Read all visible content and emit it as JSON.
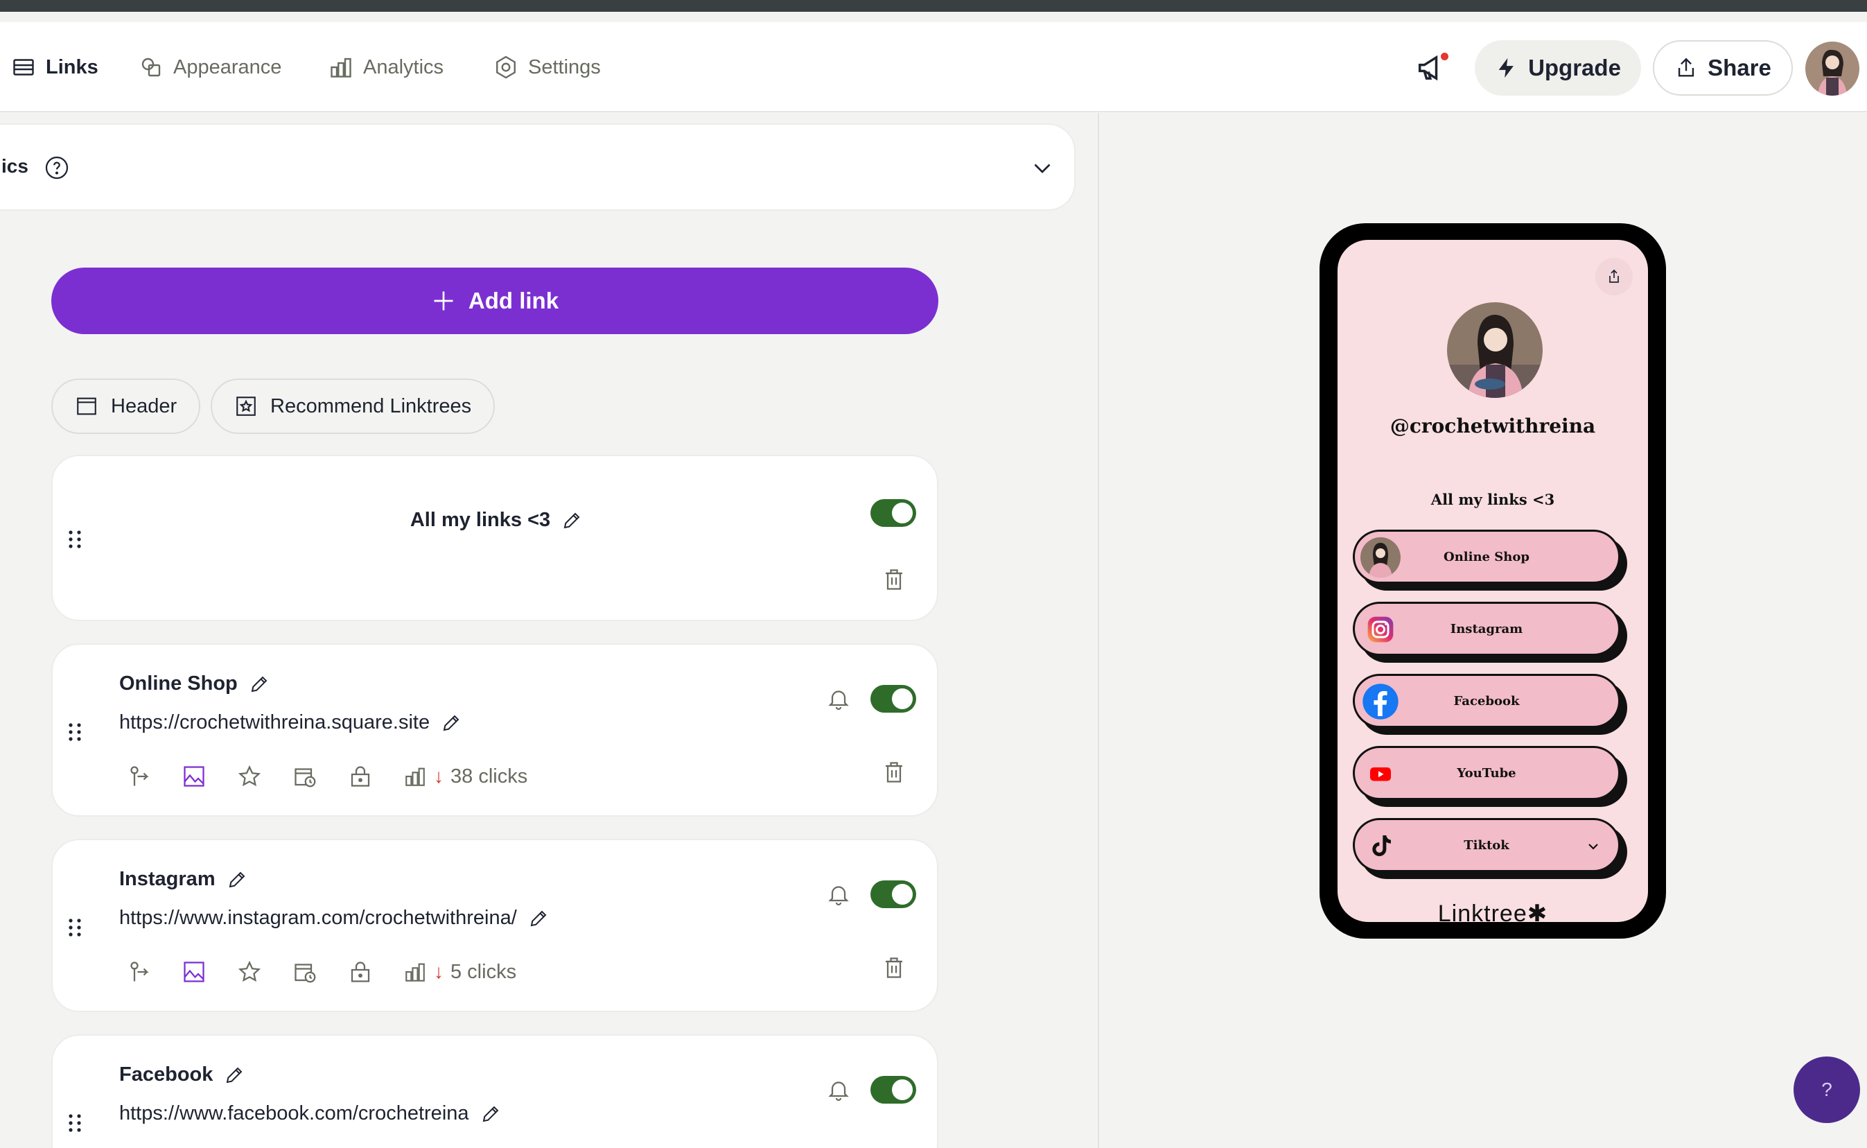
{
  "nav": {
    "items": [
      {
        "label": "Links",
        "icon": "list-icon",
        "active": true
      },
      {
        "label": "Appearance",
        "icon": "shapes-icon",
        "active": false
      },
      {
        "label": "Analytics",
        "icon": "bar-chart-icon",
        "active": false
      },
      {
        "label": "Settings",
        "icon": "gear-icon",
        "active": false
      }
    ],
    "upgrade_label": "Upgrade",
    "share_label": "Share",
    "notification_icon": "megaphone-icon"
  },
  "analytics_panel": {
    "title": "ics",
    "help_icon": "question-circle-icon",
    "expand_icon": "chevron-down-icon"
  },
  "add_link": {
    "label": "Add link",
    "icon": "plus-icon",
    "color": "#7b2fd1"
  },
  "pills": [
    {
      "label": "Header",
      "icon": "header-icon"
    },
    {
      "label": "Recommend Linktrees",
      "icon": "star-frame-icon"
    }
  ],
  "header_card": {
    "title": "All my links <3",
    "enabled": true
  },
  "link_cards": [
    {
      "title": "Online Shop",
      "url": "https://crochetwithreina.square.site",
      "clicks": "38 clicks",
      "enabled": true
    },
    {
      "title": "Instagram",
      "url": "https://www.instagram.com/crochetwithreina/",
      "clicks": "5 clicks",
      "enabled": true
    },
    {
      "title": "Facebook",
      "url": "https://www.facebook.com/crochetreina",
      "clicks": "",
      "enabled": true
    }
  ],
  "preview": {
    "handle": "@crochetwithreina",
    "bio": "All my links <3",
    "buttons": [
      {
        "label": "Online Shop",
        "icon": "profile-thumb-icon"
      },
      {
        "label": "Instagram",
        "icon": "instagram-icon"
      },
      {
        "label": "Facebook",
        "icon": "facebook-icon"
      },
      {
        "label": "YouTube",
        "icon": "youtube-icon"
      },
      {
        "label": "Tiktok",
        "icon": "tiktok-icon"
      }
    ],
    "footer_logo": "Linktree✱",
    "bg_color": "#f9dfe2",
    "button_color": "#f2bcc8"
  },
  "help_fab": {
    "label": "?"
  },
  "colors": {
    "toggle_on": "#2f6c2a",
    "accent": "#7b2fd1",
    "down": "#d03a2b"
  }
}
